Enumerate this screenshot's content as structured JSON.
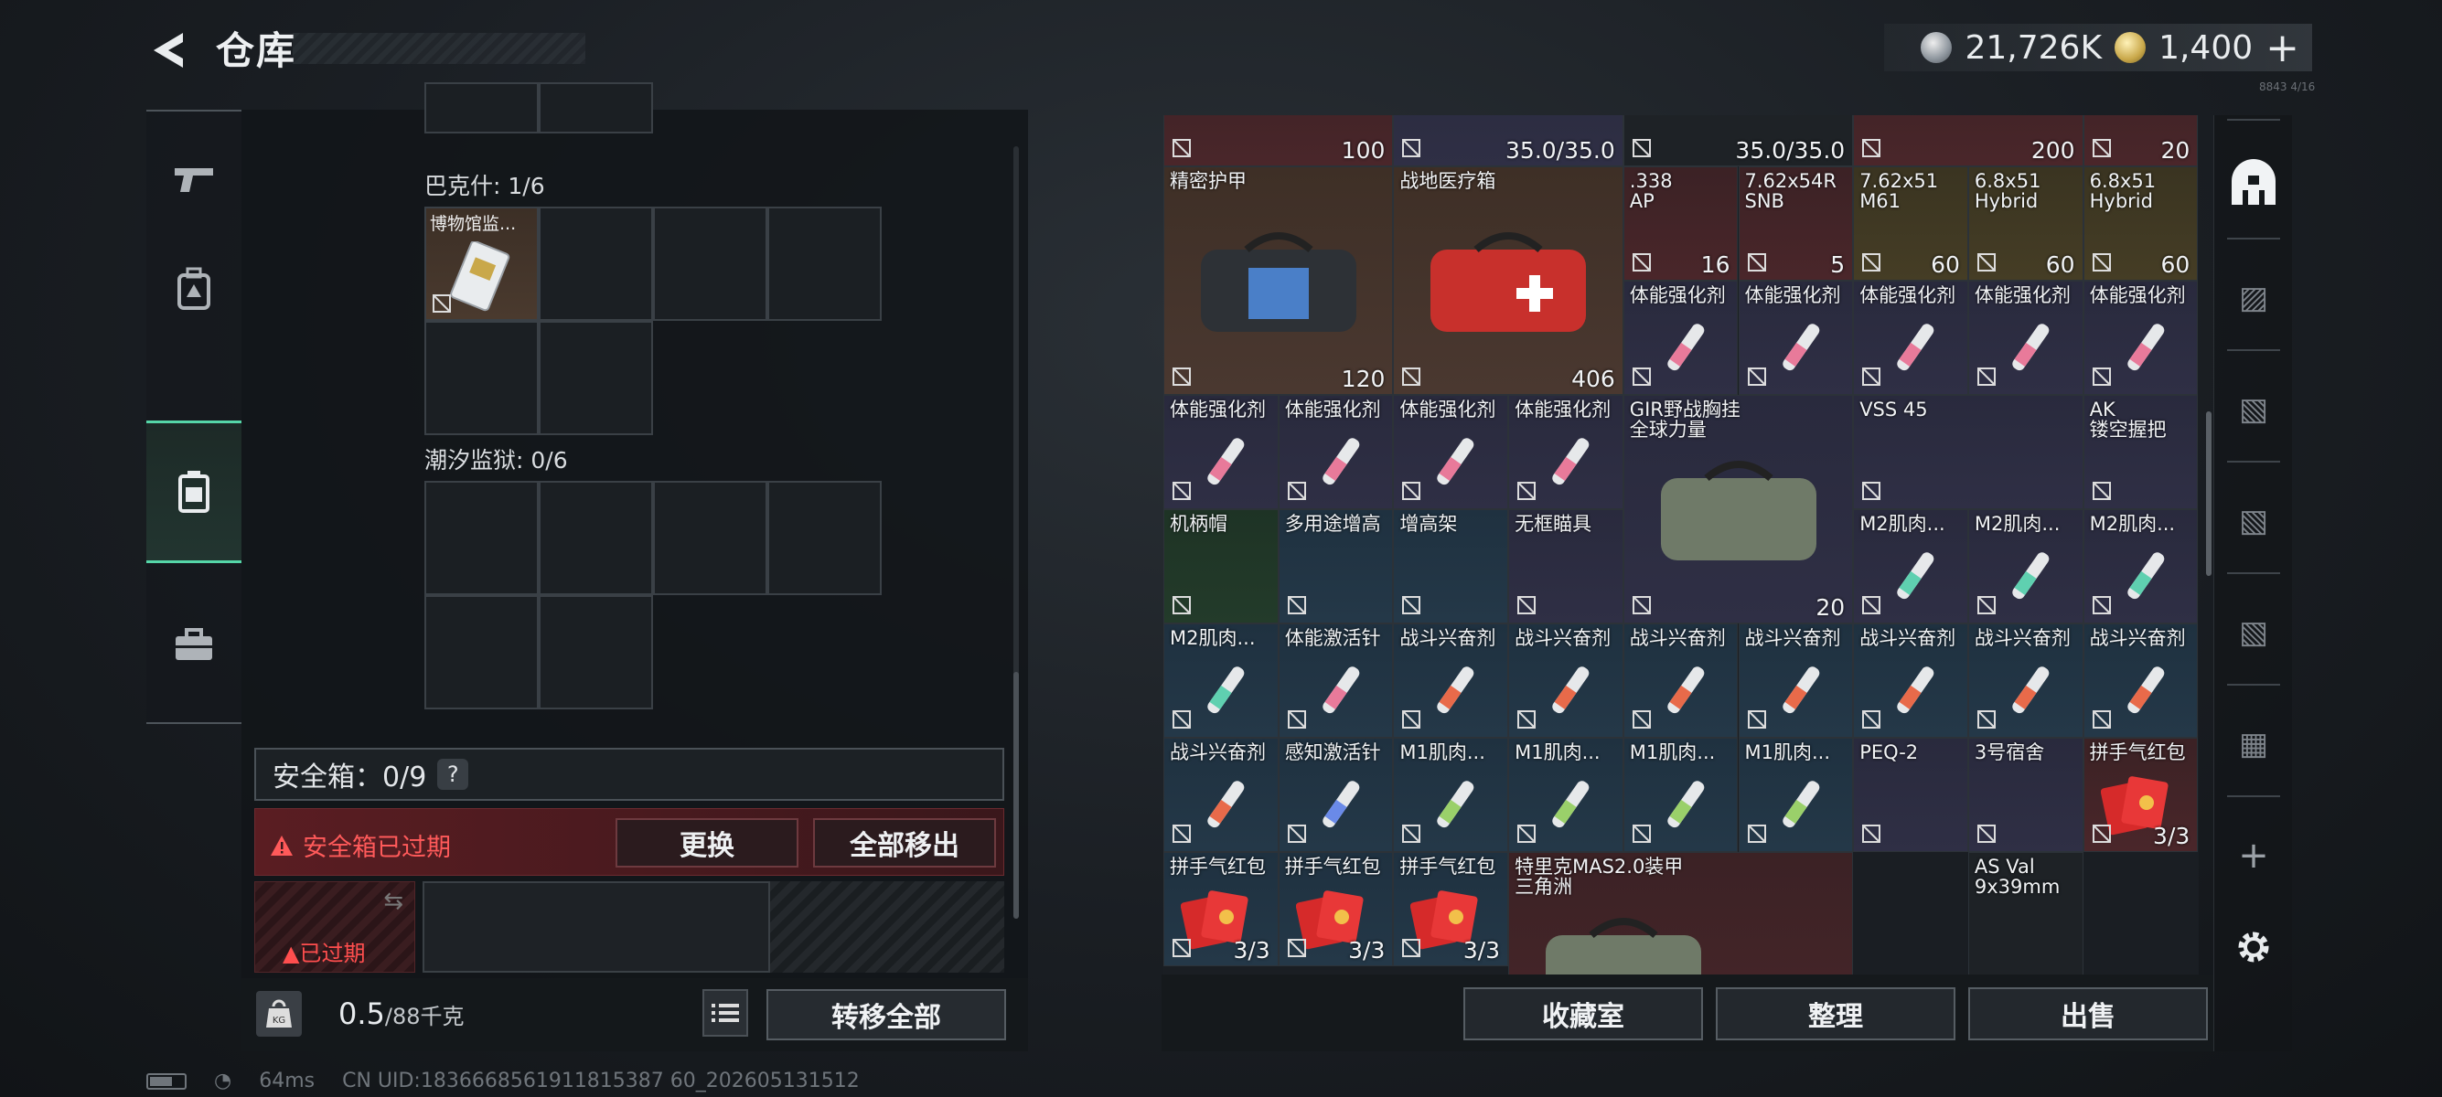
{
  "header": {
    "title": "仓库",
    "currency1": "21,726K",
    "currency2": "1,400",
    "plus": "+",
    "corner_text": "8843 4/16"
  },
  "left_panel": {
    "sections": [
      {
        "label": "巴克什: 1/6",
        "item": "博物馆监..."
      },
      {
        "label": "潮汐监狱: 0/6"
      }
    ],
    "safe_box": {
      "label": "安全箱：0/9",
      "help": "?",
      "expired": "安全箱已过期",
      "replace": "更换",
      "move_all": "全部移出",
      "expired_small": "已过期"
    },
    "weight": {
      "value": "0.5",
      "capacity": "/88千克"
    },
    "transfer_all": "转移全部"
  },
  "status": {
    "ping": "64ms",
    "uid": "CN UID:1836668561911815387 60_202605131512"
  },
  "right_panel": {
    "items": [
      {
        "name": "",
        "value": "100",
        "bg": "red"
      },
      {
        "name": "",
        "value": "35.0/35.0",
        "bg": "purple"
      },
      {
        "name": "",
        "value": "35.0/35.0",
        "bg": "dark"
      },
      {
        "name": "",
        "value": "200",
        "bg": "red"
      },
      {
        "name": "",
        "value": "20",
        "bg": "red"
      },
      {
        "name": "精密护甲",
        "value": "120",
        "bg": "brown"
      },
      {
        "name": "战地医疗箱",
        "value": "406",
        "bg": "brown"
      },
      {
        "name": ".338\nAP",
        "value": "16",
        "bg": "red"
      },
      {
        "name": "7.62x54R\nSNB",
        "value": "5",
        "bg": "red"
      },
      {
        "name": "7.62x51\nM61",
        "value": "60",
        "bg": "gold"
      },
      {
        "name": "6.8x51\nHybrid",
        "value": "60",
        "bg": "gold"
      },
      {
        "name": "6.8x51\nHybrid",
        "value": "60",
        "bg": "gold"
      },
      {
        "name": "体能强化剂",
        "bg": "purple"
      },
      {
        "name": "体能强化剂",
        "bg": "purple"
      },
      {
        "name": "体能强化剂",
        "bg": "purple"
      },
      {
        "name": "体能强化剂",
        "bg": "purple"
      },
      {
        "name": "体能强化剂",
        "bg": "purple"
      },
      {
        "name": "体能强化剂",
        "bg": "purple"
      },
      {
        "name": "体能强化剂",
        "bg": "purple"
      },
      {
        "name": "体能强化剂",
        "bg": "purple"
      },
      {
        "name": "体能强化剂",
        "bg": "purple"
      },
      {
        "name": "GIR野战胸挂\n全球力量",
        "value": "20",
        "bg": "purple"
      },
      {
        "name": "VSS 45",
        "bg": "purple"
      },
      {
        "name": "AK\n镂空握把",
        "bg": "purple"
      },
      {
        "name": "机柄帽",
        "bg": "green"
      },
      {
        "name": "多用途增高",
        "bg": "blue"
      },
      {
        "name": "增高架",
        "bg": "blue"
      },
      {
        "name": "无框瞄具",
        "bg": "purple"
      },
      {
        "name": "M2肌肉...",
        "bg": "purple"
      },
      {
        "name": "M2肌肉...",
        "bg": "purple"
      },
      {
        "name": "M2肌肉...",
        "bg": "purple"
      },
      {
        "name": "M2肌肉...",
        "bg": "blue"
      },
      {
        "name": "体能激活针",
        "bg": "blue"
      },
      {
        "name": "战斗兴奋剂",
        "bg": "blue"
      },
      {
        "name": "战斗兴奋剂",
        "bg": "blue"
      },
      {
        "name": "战斗兴奋剂",
        "bg": "blue"
      },
      {
        "name": "战斗兴奋剂",
        "bg": "blue"
      },
      {
        "name": "战斗兴奋剂",
        "bg": "blue"
      },
      {
        "name": "战斗兴奋剂",
        "bg": "blue"
      },
      {
        "name": "战斗兴奋剂",
        "bg": "blue"
      },
      {
        "name": "战斗兴奋剂",
        "bg": "blue"
      },
      {
        "name": "感知激活针",
        "bg": "blue"
      },
      {
        "name": "M1肌肉...",
        "bg": "blue"
      },
      {
        "name": "M1肌肉...",
        "bg": "blue"
      },
      {
        "name": "M1肌肉...",
        "bg": "blue"
      },
      {
        "name": "M1肌肉...",
        "bg": "blue"
      },
      {
        "name": "PEQ-2",
        "bg": "purple"
      },
      {
        "name": "3号宿舍",
        "bg": "purple"
      },
      {
        "name": "拼手气红包",
        "value": "3/3",
        "bg": "red"
      },
      {
        "name": "拼手气红包",
        "value": "3/3",
        "bg": "blue"
      },
      {
        "name": "拼手气红包",
        "value": "3/3",
        "bg": "blue"
      },
      {
        "name": "拼手气红包",
        "value": "3/3",
        "bg": "blue"
      },
      {
        "name": "特里克MAS2.0装甲\n三角洲",
        "bg": "red"
      },
      {
        "name": "AS Val\n9x39mm",
        "bg": "dark"
      }
    ],
    "buttons": {
      "collection": "收藏室",
      "organize": "整理",
      "sell": "出售"
    }
  },
  "right_nav": {
    "icons": [
      "warehouse-icon",
      "tier3-icon",
      "tier4-icon",
      "tier4b-icon",
      "tier4c-icon",
      "tier2-add-icon",
      "add-icon",
      "settings-icon"
    ]
  },
  "colors": {
    "accent": "#55d6a8",
    "danger": "#ff5a5a"
  }
}
